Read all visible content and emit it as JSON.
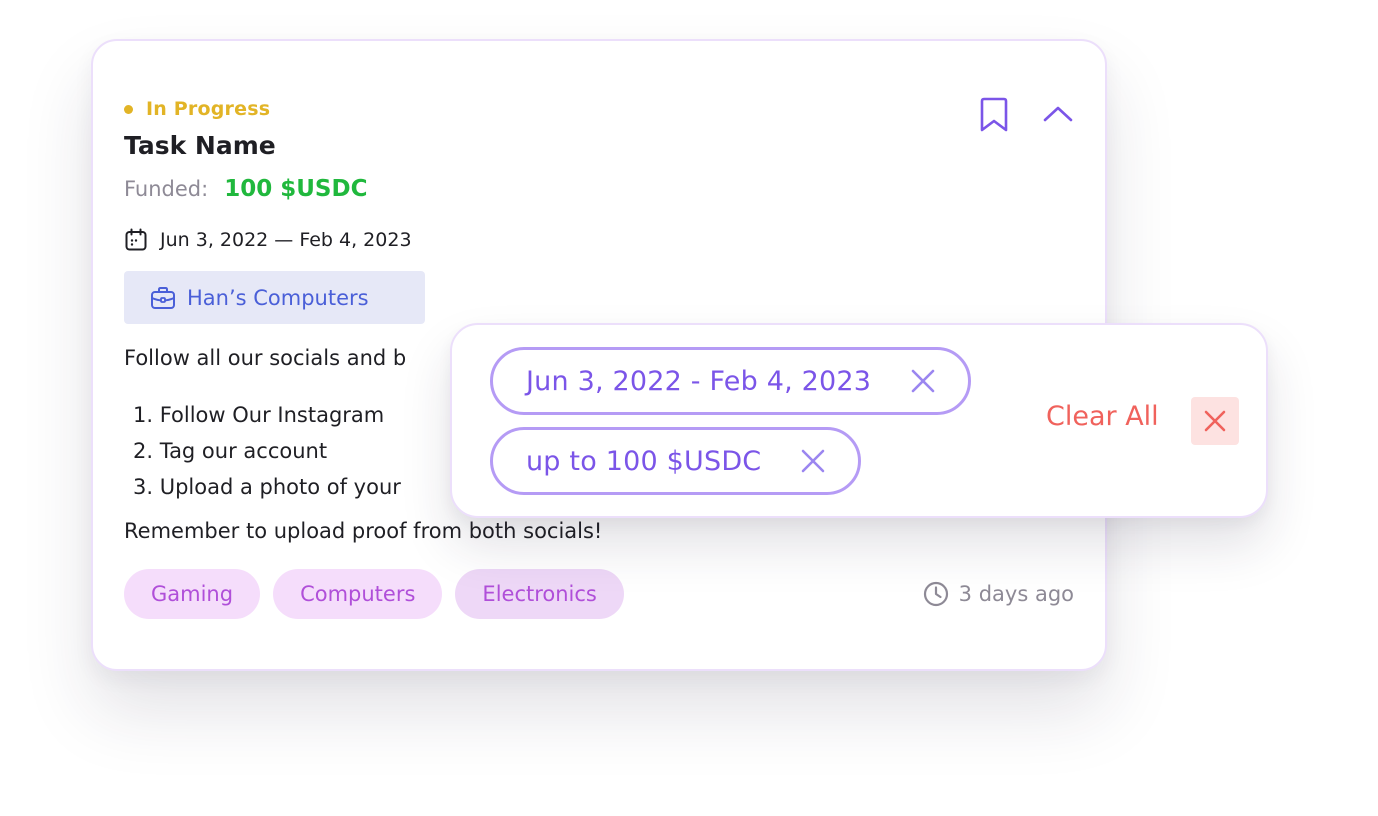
{
  "card": {
    "status": "In Progress",
    "title": "Task Name",
    "funded_label": "Funded:",
    "funded_value": "100 $USDC",
    "date_range": "Jun 3, 2022 — Feb 4, 2023",
    "company": "Han’s Computers",
    "description_intro": "Follow all our socials and b",
    "steps": [
      "1. Follow Our Instagram",
      "2. Tag our account",
      "3. Upload a photo of your"
    ],
    "reminder": "Remember to upload proof from both socials!",
    "tags": [
      "Gaming",
      "Computers",
      "Electronics"
    ],
    "posted": "3 days ago",
    "icons": {
      "calendar": "calendar-icon",
      "company": "briefcase-icon",
      "bookmark": "bookmark-icon",
      "collapse": "chevron-up-icon",
      "clock": "clock-icon"
    }
  },
  "filters": {
    "chips": [
      {
        "label": "Jun 3, 2022 - Feb 4, 2023"
      },
      {
        "label": "up to 100 $USDC"
      }
    ],
    "clear_all_label": "Clear All"
  },
  "colors": {
    "status": "#e2b426",
    "funded": "#20b83d",
    "company_text": "#4a5fd8",
    "company_bg": "#e6e8f7",
    "tag_text": "#b04fd9",
    "tag_bg": "#f5ddfb",
    "chip_text": "#7b55e8",
    "chip_border": "#b59bf5",
    "clear_all": "#f0625c",
    "clear_all_bg": "#fde2e1",
    "icon_purple": "#7b55e8"
  }
}
